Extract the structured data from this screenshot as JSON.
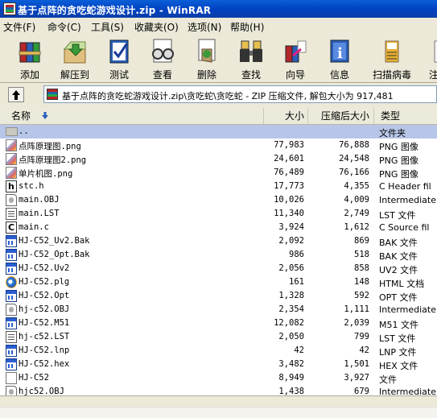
{
  "window": {
    "title": "基于点阵的贪吃蛇游戏设计.zip - WinRAR"
  },
  "menu": [
    {
      "label": "文件(F)"
    },
    {
      "label": "命令(C)"
    },
    {
      "label": "工具(S)"
    },
    {
      "label": "收藏夹(O)"
    },
    {
      "label": "选项(N)"
    },
    {
      "label": "帮助(H)"
    }
  ],
  "toolbar": [
    {
      "label": "添加",
      "icon": "add-books-icon"
    },
    {
      "label": "解压到",
      "icon": "extract-to-icon"
    },
    {
      "label": "测试",
      "icon": "test-icon"
    },
    {
      "label": "查看",
      "icon": "view-glasses-icon"
    },
    {
      "label": "删除",
      "icon": "delete-icon"
    },
    {
      "label": "查找",
      "icon": "find-binoculars-icon"
    },
    {
      "label": "向导",
      "icon": "wizard-icon"
    },
    {
      "label": "信息",
      "icon": "info-icon"
    },
    {
      "label": "扫描病毒",
      "icon": "virus-scan-icon"
    },
    {
      "label": "注",
      "icon": "comment-icon"
    }
  ],
  "address": {
    "path": "基于点阵的贪吃蛇游戏设计.zip\\贪吃蛇\\贪吃蛇 - ZIP 压缩文件, 解包大小为 917,481"
  },
  "columns": {
    "name": "名称",
    "size": "大小",
    "packed": "压缩后大小",
    "type": "类型"
  },
  "files": [
    {
      "name": "..",
      "size": "",
      "packed": "",
      "type": "文件夹",
      "icon": "folder-icon",
      "selected": true
    },
    {
      "name": "点阵原理图.png",
      "size": "77,983",
      "packed": "76,888",
      "type": "PNG 图像",
      "icon": "png-icon"
    },
    {
      "name": "点阵原理图2.png",
      "size": "24,601",
      "packed": "24,548",
      "type": "PNG 图像",
      "icon": "png-icon"
    },
    {
      "name": "单片机图.png",
      "size": "76,489",
      "packed": "76,166",
      "type": "PNG 图像",
      "icon": "png-icon"
    },
    {
      "name": "stc.h",
      "size": "17,773",
      "packed": "4,355",
      "type": "C Header fil",
      "icon": "h-file-icon"
    },
    {
      "name": "main.OBJ",
      "size": "10,026",
      "packed": "4,009",
      "type": "Intermediate",
      "icon": "obj-file-icon"
    },
    {
      "name": "main.LST",
      "size": "11,340",
      "packed": "2,749",
      "type": "LST 文件",
      "icon": "text-file-icon"
    },
    {
      "name": "main.c",
      "size": "3,924",
      "packed": "1,612",
      "type": "C Source fil",
      "icon": "c-file-icon"
    },
    {
      "name": "HJ-C52_Uv2.Bak",
      "size": "2,092",
      "packed": "869",
      "type": "BAK 文件",
      "icon": "window-file-icon"
    },
    {
      "name": "HJ-C52_Opt.Bak",
      "size": "986",
      "packed": "518",
      "type": "BAK 文件",
      "icon": "window-file-icon"
    },
    {
      "name": "HJ-C52.Uv2",
      "size": "2,056",
      "packed": "858",
      "type": "UV2 文件",
      "icon": "window-file-icon"
    },
    {
      "name": "HJ-C52.plg",
      "size": "161",
      "packed": "148",
      "type": "HTML 文档",
      "icon": "ie-icon"
    },
    {
      "name": "HJ-C52.Opt",
      "size": "1,328",
      "packed": "592",
      "type": "OPT 文件",
      "icon": "window-file-icon"
    },
    {
      "name": "hj-c52.OBJ",
      "size": "2,354",
      "packed": "1,111",
      "type": "Intermediate",
      "icon": "obj-file-icon"
    },
    {
      "name": "HJ-C52.M51",
      "size": "12,082",
      "packed": "2,039",
      "type": "M51 文件",
      "icon": "window-file-icon"
    },
    {
      "name": "hj-c52.LST",
      "size": "2,050",
      "packed": "799",
      "type": "LST 文件",
      "icon": "text-file-icon"
    },
    {
      "name": "HJ-C52.lnp",
      "size": "42",
      "packed": "42",
      "type": "LNP 文件",
      "icon": "window-file-icon"
    },
    {
      "name": "HJ-C52.hex",
      "size": "3,482",
      "packed": "1,501",
      "type": "HEX 文件",
      "icon": "window-file-icon"
    },
    {
      "name": "HJ-C52",
      "size": "8,949",
      "packed": "3,927",
      "type": "文件",
      "icon": "blank-file-icon"
    },
    {
      "name": "hjc52.OBJ",
      "size": "1,438",
      "packed": "679",
      "type": "Intermediate",
      "icon": "obj-file-icon"
    }
  ]
}
